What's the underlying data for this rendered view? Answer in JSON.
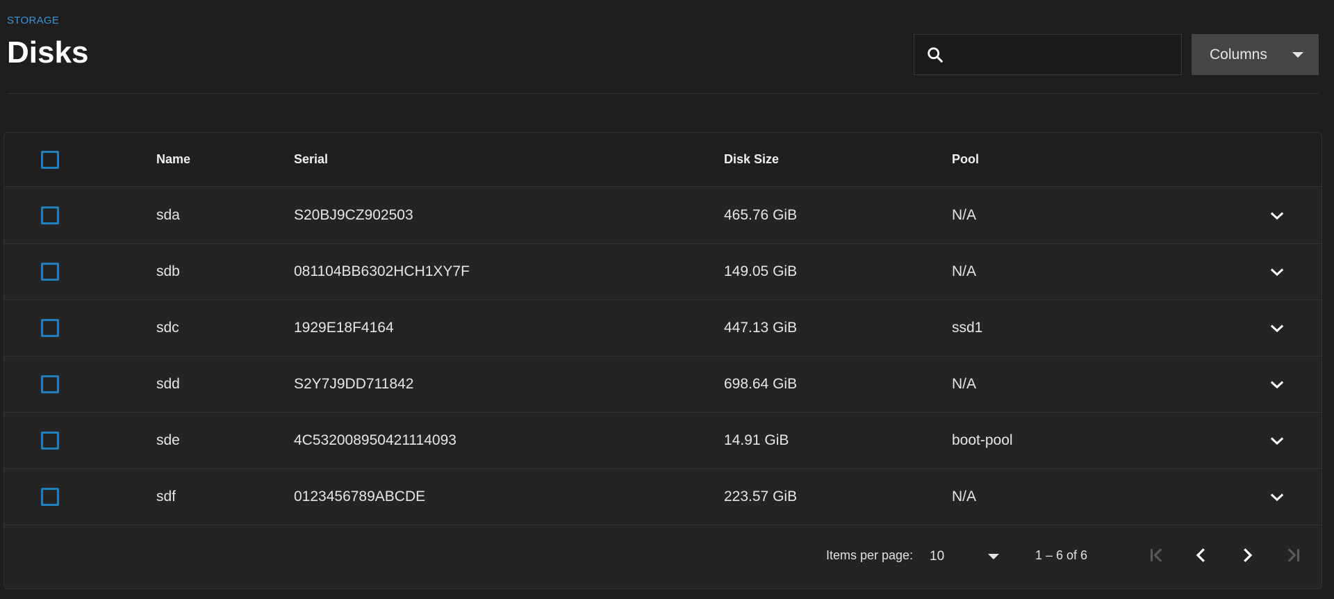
{
  "header": {
    "breadcrumb": "STORAGE",
    "title": "Disks",
    "search": {
      "value": "",
      "placeholder": ""
    },
    "columns_button": "Columns"
  },
  "table": {
    "headers": {
      "name": "Name",
      "serial": "Serial",
      "disk_size": "Disk Size",
      "pool": "Pool"
    },
    "rows": [
      {
        "name": "sda",
        "serial": "S20BJ9CZ902503",
        "disk_size": "465.76 GiB",
        "pool": "N/A"
      },
      {
        "name": "sdb",
        "serial": "081104BB6302HCH1XY7F",
        "disk_size": "149.05 GiB",
        "pool": "N/A"
      },
      {
        "name": "sdc",
        "serial": "1929E18F4164",
        "disk_size": "447.13 GiB",
        "pool": "ssd1"
      },
      {
        "name": "sdd",
        "serial": "S2Y7J9DD711842",
        "disk_size": "698.64 GiB",
        "pool": "N/A"
      },
      {
        "name": "sde",
        "serial": "4C532008950421114093",
        "disk_size": "14.91 GiB",
        "pool": "boot-pool"
      },
      {
        "name": "sdf",
        "serial": "0123456789ABCDE",
        "disk_size": "223.57 GiB",
        "pool": "N/A"
      }
    ]
  },
  "paginator": {
    "items_per_page_label": "Items per page:",
    "items_per_page_value": "10",
    "range_label": "1 – 6 of 6"
  },
  "colors": {
    "accent": "#1e7fc1",
    "breadcrumb": "#3b95d6",
    "background": "#1e1e1e",
    "card": "#242424"
  },
  "icons": {
    "search": "search-icon",
    "columns_dropdown": "caret-down-icon",
    "row_expand": "chevron-down-icon",
    "first_page": "first-page-icon",
    "prev_page": "chevron-left-icon",
    "next_page": "chevron-right-icon",
    "last_page": "last-page-icon"
  }
}
